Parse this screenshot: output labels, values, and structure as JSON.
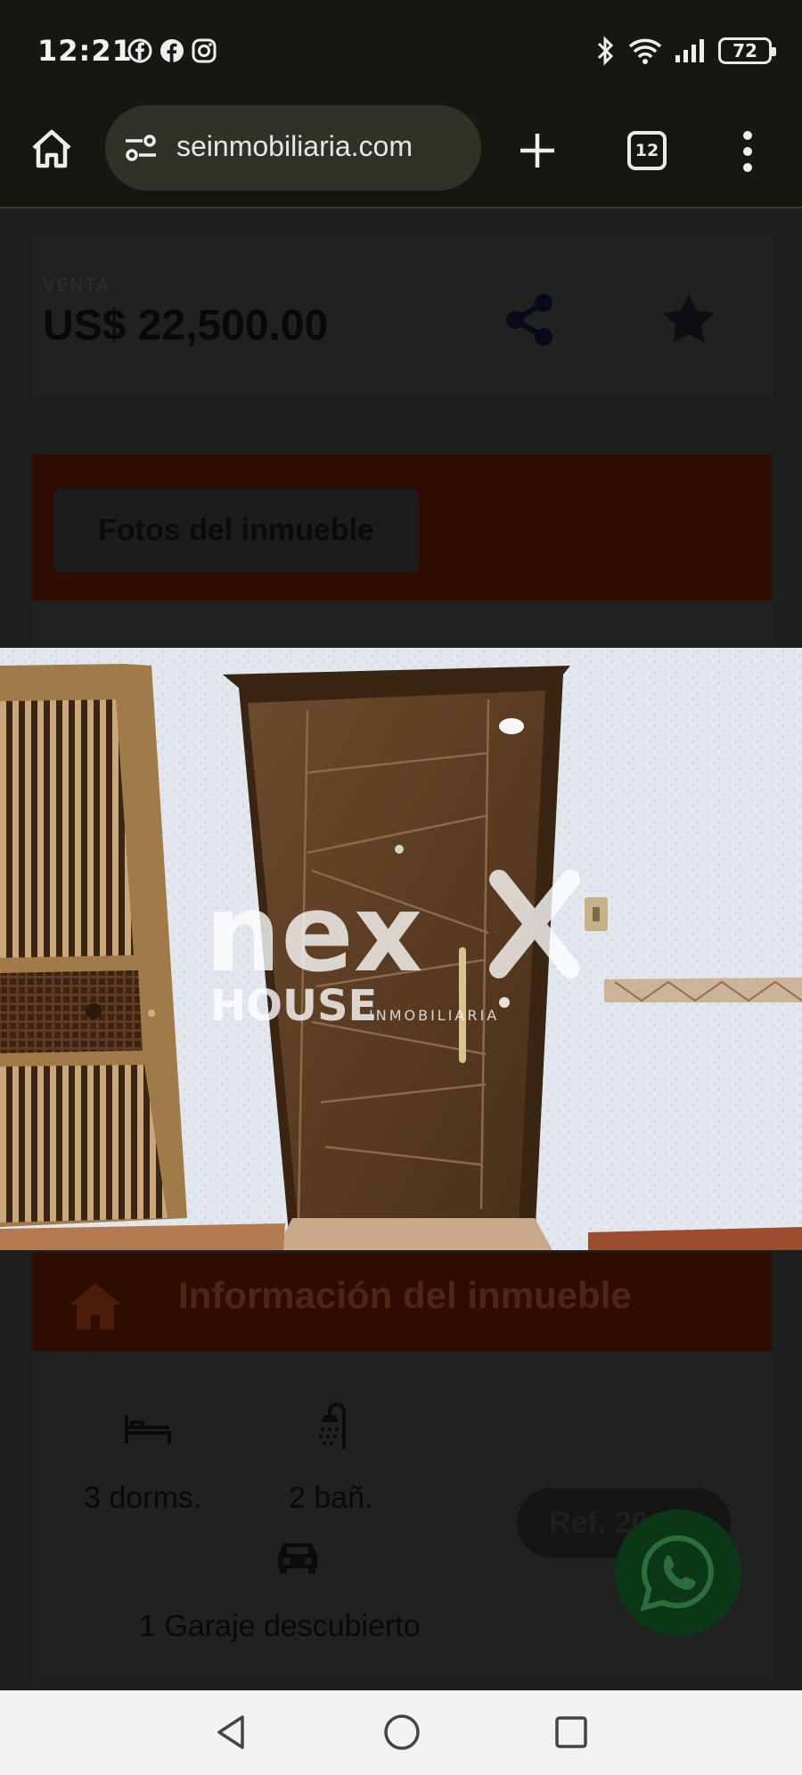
{
  "status_bar": {
    "time": "12:21",
    "notification_icons": [
      "facebook-outline-icon",
      "facebook-icon",
      "instagram-icon"
    ],
    "system_icons": [
      "bluetooth-icon",
      "wifi-icon",
      "signal-icon"
    ],
    "battery_level": "72"
  },
  "browser": {
    "url_display": "seinmobiliaria.com",
    "tab_count": "12"
  },
  "listing": {
    "price_label": "VENTA",
    "price": "US$ 22,500.00",
    "photos_button": "Fotos del inmueble",
    "info_title": "Información del inmueble",
    "features": {
      "bedrooms": "3 dorms.",
      "bathrooms": "2 bañ.",
      "garage": "1 Garaje descubierto"
    },
    "ref_label": "Ref. 20"
  },
  "photo": {
    "watermark_main": "nex",
    "watermark_brand": "HOUSE",
    "watermark_sub": "INMOBILIARIA"
  },
  "colors": {
    "accent_band": "#2e0d00",
    "whatsapp": "#0b3716",
    "status_bg": "#171711"
  }
}
